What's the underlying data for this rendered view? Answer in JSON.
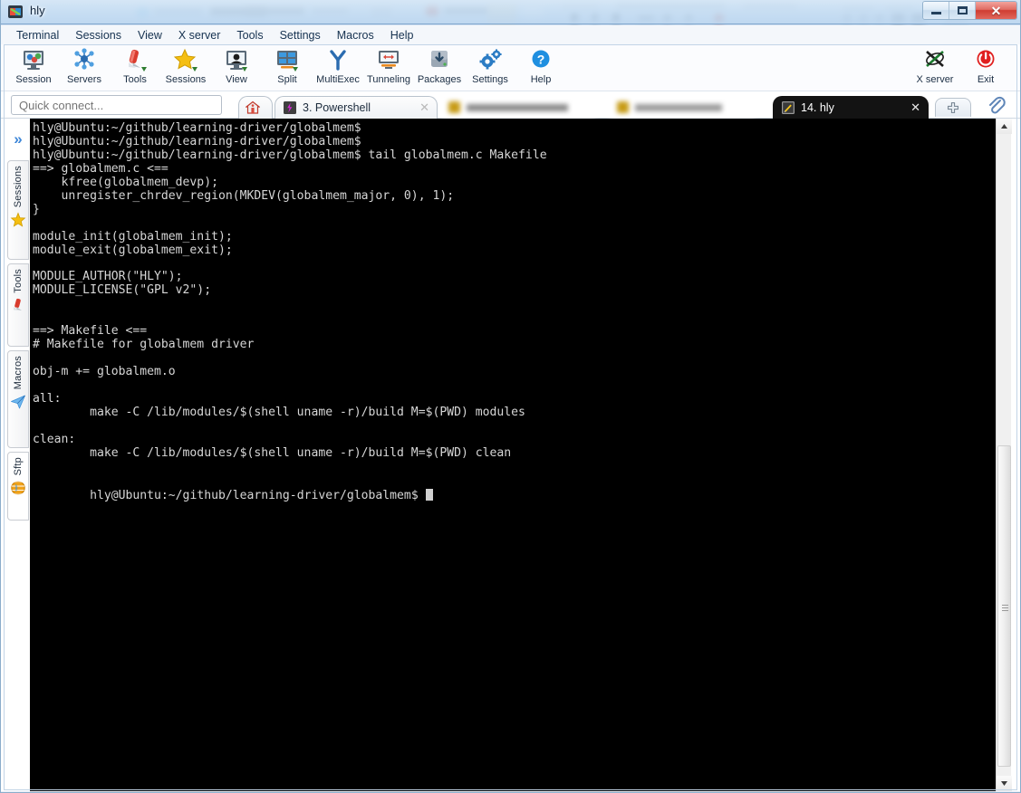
{
  "window": {
    "title": "hly",
    "app_icon": "mobaxterm-icon",
    "controls": {
      "minimize": "–",
      "maximize": "□",
      "close": "✕"
    }
  },
  "menubar": {
    "items": [
      {
        "label": "Terminal",
        "name": "menu-terminal"
      },
      {
        "label": "Sessions",
        "name": "menu-sessions"
      },
      {
        "label": "View",
        "name": "menu-view"
      },
      {
        "label": "X server",
        "name": "menu-x-server"
      },
      {
        "label": "Tools",
        "name": "menu-tools"
      },
      {
        "label": "Settings",
        "name": "menu-settings"
      },
      {
        "label": "Macros",
        "name": "menu-macros"
      },
      {
        "label": "Help",
        "name": "menu-help"
      }
    ]
  },
  "toolbar": {
    "items": [
      {
        "label": "Session",
        "icon": "session-icon"
      },
      {
        "label": "Servers",
        "icon": "servers-icon"
      },
      {
        "label": "Tools",
        "icon": "tools-icon"
      },
      {
        "label": "Sessions",
        "icon": "sessions-star-icon"
      },
      {
        "label": "View",
        "icon": "view-icon"
      },
      {
        "label": "Split",
        "icon": "split-icon"
      },
      {
        "label": "MultiExec",
        "icon": "multiexec-icon"
      },
      {
        "label": "Tunneling",
        "icon": "tunneling-icon"
      },
      {
        "label": "Packages",
        "icon": "packages-icon"
      },
      {
        "label": "Settings",
        "icon": "settings-gear-icon"
      },
      {
        "label": "Help",
        "icon": "help-icon"
      }
    ],
    "right_items": [
      {
        "label": "X server",
        "icon": "x-server-icon"
      },
      {
        "label": "Exit",
        "icon": "power-exit-icon"
      }
    ]
  },
  "quick_connect": {
    "placeholder": "Quick connect...",
    "value": ""
  },
  "tabs": {
    "home_label": "",
    "items": [
      {
        "label": "3. Powershell",
        "icon": "powershell-icon",
        "active": false,
        "close": "✕"
      },
      {
        "label": "14. hly",
        "icon": "ssh-session-icon",
        "active": true,
        "close": "✕"
      }
    ],
    "new_tab_label": "+"
  },
  "sidebar": {
    "expand_glyph": "»",
    "items": [
      {
        "label": "Sessions",
        "icon": "star-icon"
      },
      {
        "label": "Tools",
        "icon": "swiss-knife-icon"
      },
      {
        "label": "Macros",
        "icon": "paper-plane-icon"
      },
      {
        "label": "Sftp",
        "icon": "globe-icon"
      }
    ]
  },
  "terminal": {
    "prompt": "hly@Ubuntu:~/github/learning-driver/globalmem$",
    "content": "hly@Ubuntu:~/github/learning-driver/globalmem$\nhly@Ubuntu:~/github/learning-driver/globalmem$\nhly@Ubuntu:~/github/learning-driver/globalmem$ tail globalmem.c Makefile\n==> globalmem.c <==\n    kfree(globalmem_devp);\n    unregister_chrdev_region(MKDEV(globalmem_major, 0), 1);\n}\n\nmodule_init(globalmem_init);\nmodule_exit(globalmem_exit);\n\nMODULE_AUTHOR(\"HLY\");\nMODULE_LICENSE(\"GPL v2\");\n\n\n==> Makefile <==\n# Makefile for globalmem driver\n\nobj-m += globalmem.o\n\nall:\n        make -C /lib/modules/$(shell uname -r)/build M=$(PWD) modules\n\nclean:\n        make -C /lib/modules/$(shell uname -r)/build M=$(PWD) clean\n\n",
    "last_prompt": "hly@Ubuntu:~/github/learning-driver/globalmem$ "
  },
  "scrollbar": {
    "up_glyph": "▲",
    "down_glyph": "▼"
  },
  "colors": {
    "terminal_bg": "#000000",
    "terminal_fg": "#d7d7d7",
    "accent_blue": "#3f87d8",
    "close_red": "#cf3c31",
    "active_tab_bg": "#131313"
  }
}
